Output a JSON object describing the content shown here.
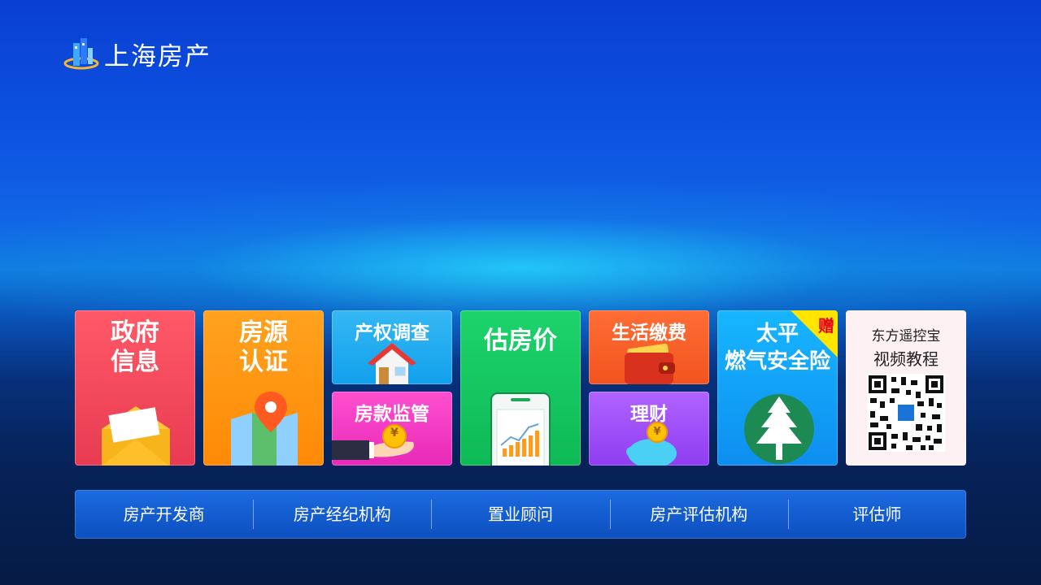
{
  "app": {
    "title": "上海房产"
  },
  "tiles": [
    {
      "id": "gov",
      "lines": [
        "政府",
        "信息"
      ],
      "icon": "envelope-icon"
    },
    {
      "id": "auth",
      "lines": [
        "房源",
        "认证"
      ],
      "icon": "map-pin-icon"
    },
    {
      "id": "prop",
      "label": "产权调查",
      "icon": "house-icon"
    },
    {
      "id": "fund",
      "label": "房款监管",
      "icon": "coin-hand-icon"
    },
    {
      "id": "est",
      "label": "估房价",
      "icon": "phone-chart-icon"
    },
    {
      "id": "life",
      "label": "生活缴费",
      "icon": "wallet-icon"
    },
    {
      "id": "fin",
      "label": "理财",
      "icon": "piggy-bank-icon"
    },
    {
      "id": "ins",
      "lines": [
        "太平",
        "燃气安全险"
      ],
      "badge": "赠",
      "icon": "pine-tree-icon"
    },
    {
      "id": "qr",
      "lines": [
        "东方遥控宝",
        "视频教程"
      ],
      "icon": "qr-code-icon"
    }
  ],
  "icon_glyphs": {
    "coin": "¥"
  },
  "bottom_nav": [
    {
      "label": "房产开发商"
    },
    {
      "label": "房产经纪机构"
    },
    {
      "label": "置业顾问"
    },
    {
      "label": "房产评估机构"
    },
    {
      "label": "评估师"
    }
  ],
  "colors": {
    "gov": "#ff5968",
    "auth": "#ffa21e",
    "prop": "#35b8f4",
    "fund": "#ff4fd0",
    "est": "#1dd36c",
    "life": "#ff6d35",
    "fin": "#b063ff",
    "ins": "#17b6ff",
    "qr": "#fdf1f4"
  }
}
